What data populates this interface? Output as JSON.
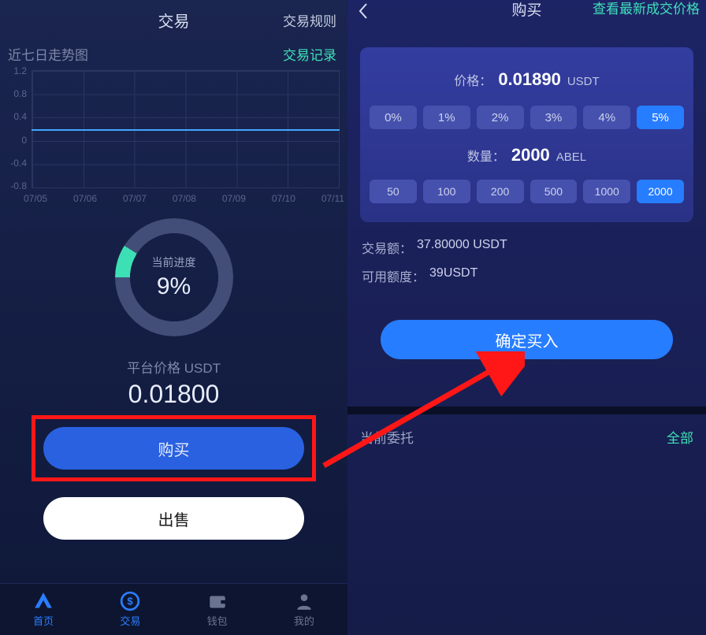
{
  "left": {
    "title": "交易",
    "rules": "交易规则",
    "chart_title": "近七日走势图",
    "records": "交易记录",
    "progress_label": "当前进度",
    "progress_value": "9%",
    "price_label": "平台价格 USDT",
    "price_value": "0.01800",
    "buy_btn": "购买",
    "sell_btn": "出售"
  },
  "nav": {
    "home": "首页",
    "trade": "交易",
    "wallet": "钱包",
    "mine": "我的"
  },
  "right": {
    "title": "购买",
    "latest": "查看最新成交价格",
    "price_label": "价格：",
    "price_value": "0.01890",
    "price_unit": "USDT",
    "pct": [
      "0%",
      "1%",
      "2%",
      "3%",
      "4%",
      "5%"
    ],
    "qty_label": "数量：",
    "qty_value": "2000",
    "qty_unit": "ABEL",
    "qtys": [
      "50",
      "100",
      "200",
      "500",
      "1000",
      "2000"
    ],
    "amount_label": "交易额：",
    "amount_value": "37.80000 USDT",
    "avail_label": "可用额度：",
    "avail_value": "39USDT",
    "confirm": "确定买入",
    "orders_label": "当前委托",
    "orders_all": "全部"
  },
  "chart_data": {
    "type": "line",
    "title": "近七日走势图",
    "x": [
      "07/05",
      "07/06",
      "07/07",
      "07/08",
      "07/09",
      "07/10",
      "07/11"
    ],
    "values": [
      0.0,
      0.0,
      0.0,
      0.0,
      0.0,
      0.0,
      0.0
    ],
    "ylim": [
      -0.8,
      1.2
    ],
    "yticks": [
      1.2,
      0.8,
      0.4,
      0.0,
      -0.4,
      -0.8
    ],
    "ylabel": "",
    "xlabel": ""
  }
}
